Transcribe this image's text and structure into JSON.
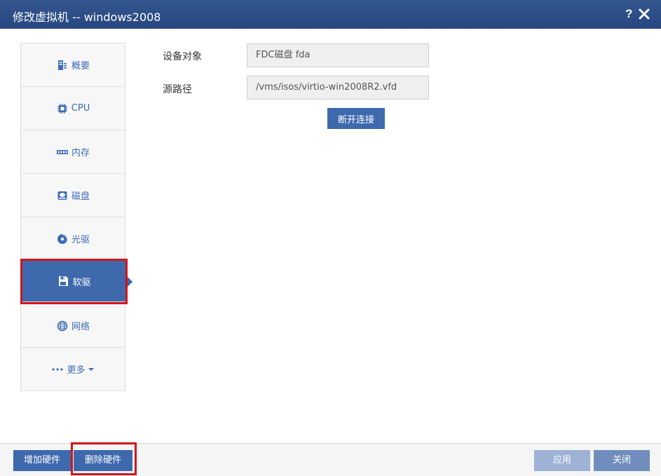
{
  "window": {
    "title": "修改虚拟机 -- windows2008",
    "help_label": "?",
    "close_icon": "close-icon"
  },
  "sidebar": {
    "items": [
      {
        "label": "概要",
        "icon": "summary-icon"
      },
      {
        "label": "CPU",
        "icon": "cpu-icon"
      },
      {
        "label": "内存",
        "icon": "memory-icon"
      },
      {
        "label": "磁盘",
        "icon": "disk-icon"
      },
      {
        "label": "光驱",
        "icon": "cdrom-icon"
      },
      {
        "label": "软驱",
        "icon": "floppy-icon",
        "active": true
      },
      {
        "label": "网络",
        "icon": "network-icon"
      },
      {
        "label": "更多",
        "icon": "more-icon"
      }
    ]
  },
  "form": {
    "device_label": "设备对象",
    "device_value": "FDC磁盘 fda",
    "path_label": "源路径",
    "path_value": "/vms/isos/virtio-win2008R2.vfd",
    "disconnect_label": "断开连接"
  },
  "footer": {
    "add_hardware": "增加硬件",
    "remove_hardware": "删除硬件",
    "apply": "应用",
    "close": "关闭"
  },
  "colors": {
    "titlebar": "#2a4c86",
    "accent": "#3e69ad",
    "highlight": "#d4141a",
    "sidebar_text": "#3d6db4"
  }
}
